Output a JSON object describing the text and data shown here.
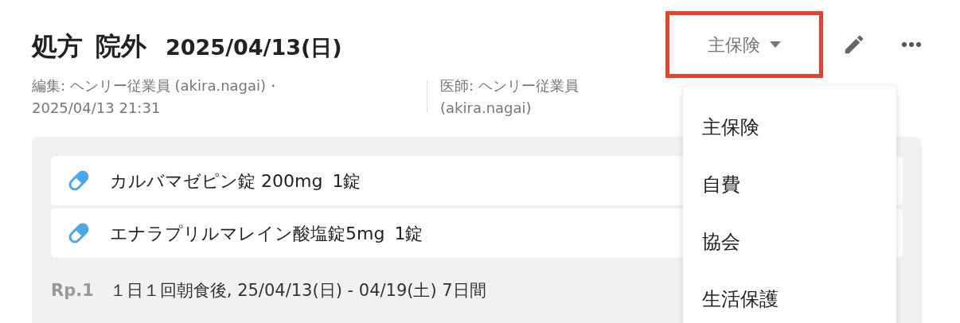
{
  "header": {
    "title": [
      "処方",
      "院外"
    ],
    "date": "2025/04/13(日)",
    "editor_lines": [
      "編集: ヘンリー従業員 (akira.nagai)・",
      "2025/04/13 21:31"
    ],
    "doctor_lines": [
      "医師: ヘンリー従業員",
      "(akira.nagai)"
    ],
    "insurance_dropdown": {
      "label": "主保険",
      "highlighted": true
    }
  },
  "prescription": {
    "medications": [
      {
        "name": "カルバマゼピン錠 200mg",
        "dose": "1錠"
      },
      {
        "name": "エナラプリルマレイン酸塩錠5mg",
        "dose": "1錠"
      }
    ],
    "rp_label": "Rp.1",
    "usage": "１日１回朝食後,  25/04/13(日) - 04/19(土) 7日間"
  },
  "insurance_menu": {
    "items": [
      "主保険",
      "自費",
      "協会",
      "生活保護"
    ]
  }
}
